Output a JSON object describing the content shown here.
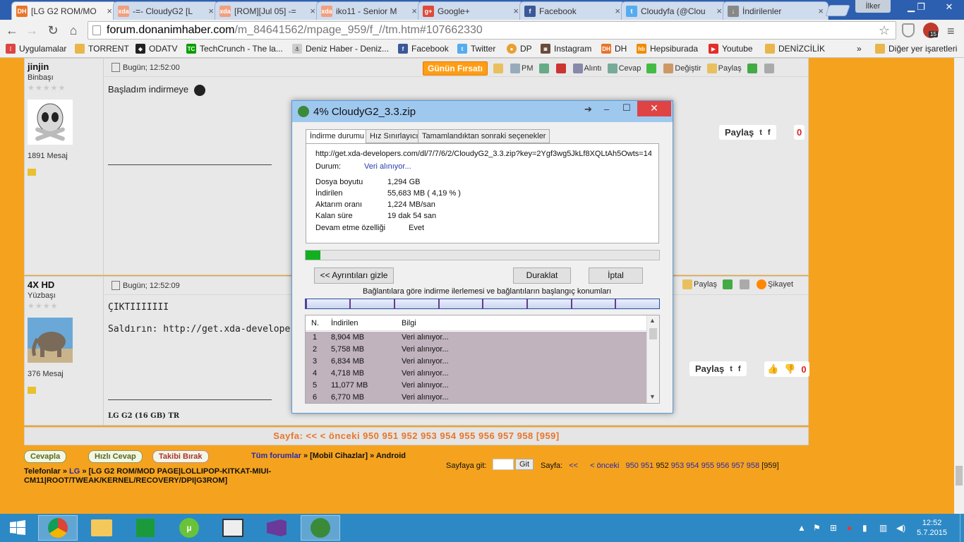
{
  "browser": {
    "tabs": [
      {
        "label": "[LG G2 ROM/MO",
        "favicon": "DH",
        "color": "#e8752a"
      },
      {
        "label": "-=- CloudyG2 [L",
        "favicon": "xda",
        "color": "#f0a080"
      },
      {
        "label": "[ROM][Jul 05] -=",
        "favicon": "xda",
        "color": "#f0a080"
      },
      {
        "label": "iko11 - Senior M",
        "favicon": "xda",
        "color": "#f0a080"
      },
      {
        "label": "Google+",
        "favicon": "g+",
        "color": "#dd4b39"
      },
      {
        "label": "Facebook",
        "favicon": "f",
        "color": "#3b5998"
      },
      {
        "label": "Cloudyfa (@Clou",
        "favicon": "t",
        "color": "#55acee"
      },
      {
        "label": "İndirilenler",
        "favicon": "↓",
        "color": "#888888"
      }
    ],
    "user_label": "İlker",
    "url_host": "forum.donanimhaber.com",
    "url_path": "/m_84641562/mpage_959/f_//tm.htm#107662330",
    "extension_badge": "15",
    "bookmarks": [
      {
        "label": "Uygulamalar",
        "icon": "apps-icon"
      },
      {
        "label": "TORRENT",
        "icon": "folder-icon"
      },
      {
        "label": "ODATV",
        "icon": "odatv-icon"
      },
      {
        "label": "TechCrunch - The la...",
        "icon": "techcrunch-icon"
      },
      {
        "label": "Deniz Haber - Deniz...",
        "icon": "denizhaber-icon"
      },
      {
        "label": "Facebook",
        "icon": "facebook-icon"
      },
      {
        "label": "Twitter",
        "icon": "twitter-icon"
      },
      {
        "label": "DP",
        "icon": "dp-icon"
      },
      {
        "label": "Instagram",
        "icon": "instagram-icon"
      },
      {
        "label": "DH",
        "icon": "dh-icon"
      },
      {
        "label": "Hepsiburada",
        "icon": "hepsiburada-icon"
      },
      {
        "label": "Youtube",
        "icon": "youtube-icon"
      },
      {
        "label": "DENİZCİLİK",
        "icon": "folder-icon"
      }
    ],
    "bookmarks_more": "»",
    "other_bookmarks": "Diğer yer işaretleri"
  },
  "posts": [
    {
      "username": "jinjin",
      "rank": "Binbaşı",
      "stars": "★★★★★",
      "message_count": "1891 Mesaj",
      "timestamp": "Bugün; 12:52:00",
      "body": "Başladım indirmeye",
      "actions": [
        "Alıntı",
        "Cevap",
        "Değiştir",
        "Paylaş"
      ],
      "pm": "PM",
      "deal": "Günün Fırsatı",
      "share_label": "Paylaş",
      "share_count": "0"
    },
    {
      "username": "4X HD",
      "rank": "Yüzbaşı",
      "stars": "★★★★",
      "message_count": "376 Mesaj",
      "timestamp": "Bugün; 12:52:09",
      "body_line1": "ÇIKTIIIIIII",
      "body_line2": "Saldırın: http://get.xda-develope...Co1",
      "signature": "LG G2 (16 GB) TR",
      "actions": [
        "Paylaş",
        "Şikayet"
      ],
      "share_label": "Paylaş",
      "share_count": "0"
    }
  ],
  "pager": {
    "text": "Sayfa:   <<    < önceki  950 951 952 953 954 955 956 957 958 [959]"
  },
  "footer": {
    "reply": "Cevapla",
    "quick_reply": "Hızlı Cevap",
    "unfollow": "Takibi Bırak",
    "all_forums": "Tüm forumlar",
    "crumb_mid": " » [Mobil Cihazlar] » Android",
    "crumb_line2a": "Telefonlar",
    "crumb_line2b": "LG",
    "crumb_line2c": " » [LG G2 ROM/MOD PAGE|LOLLIPOP-KITKAT-MIUI-",
    "crumb_line3": "CM11|ROOT/TWEAK/KERNEL/RECOVERY/DPI|G3ROM]",
    "goto_label": "Sayfaya git:",
    "goto_button": "Git",
    "sayfa": "Sayfa:",
    "pager_prefix": "<<",
    "pager_prev": "< önceki",
    "pager_pages": "950 951",
    "pager_current_black": "952",
    "pager_pages2": "953 954 955 956 957 958",
    "pager_last": "[959]"
  },
  "download": {
    "title": "4% CloudyG2_3.3.zip",
    "tabs": [
      "İndirme durumu",
      "Hız Sınırlayıcı",
      "Tamamlandıktan sonraki seçenekler"
    ],
    "url": "http://get.xda-developers.com/dl/7/7/6/2/CloudyG2_3.3.zip?key=2Ygf3wg5JkLf8XQLtAh5Owts=14",
    "status_label": "Durum:",
    "status_value": "Veri alınıyor...",
    "size_label": "Dosya boyutu",
    "size_value": "1,294  GB",
    "downloaded_label": "İndirilen",
    "downloaded_value": "55,683  MB  ( 4,19 % )",
    "rate_label": "Aktarım oranı",
    "rate_value": "1,224  MB/san",
    "remaining_label": "Kalan süre",
    "remaining_value": "19 dak 54 san",
    "resume_label": "Devam etme özelliği",
    "resume_value": "Evet",
    "progress_percent": 4.19,
    "hide_details": "<< Ayrıntıları gizle",
    "pause": "Duraklat",
    "cancel": "İptal",
    "connections_caption": "Bağlantılara göre indirme ilerlemesi ve bağlantıların başlangıç konumları",
    "list_headers": [
      "N.",
      "İndirilen",
      "Bilgi"
    ],
    "rows": [
      {
        "n": "1",
        "downloaded": "8,904  MB",
        "info": "Veri alınıyor..."
      },
      {
        "n": "2",
        "downloaded": "5,758  MB",
        "info": "Veri alınıyor..."
      },
      {
        "n": "3",
        "downloaded": "6,834  MB",
        "info": "Veri alınıyor..."
      },
      {
        "n": "4",
        "downloaded": "4,718  MB",
        "info": "Veri alınıyor..."
      },
      {
        "n": "5",
        "downloaded": "11,077  MB",
        "info": "Veri alınıyor..."
      },
      {
        "n": "6",
        "downloaded": "6,770  MB",
        "info": "Veri alınıyor..."
      }
    ]
  },
  "taskbar": {
    "time": "12:52",
    "date": "5.7.2015"
  }
}
